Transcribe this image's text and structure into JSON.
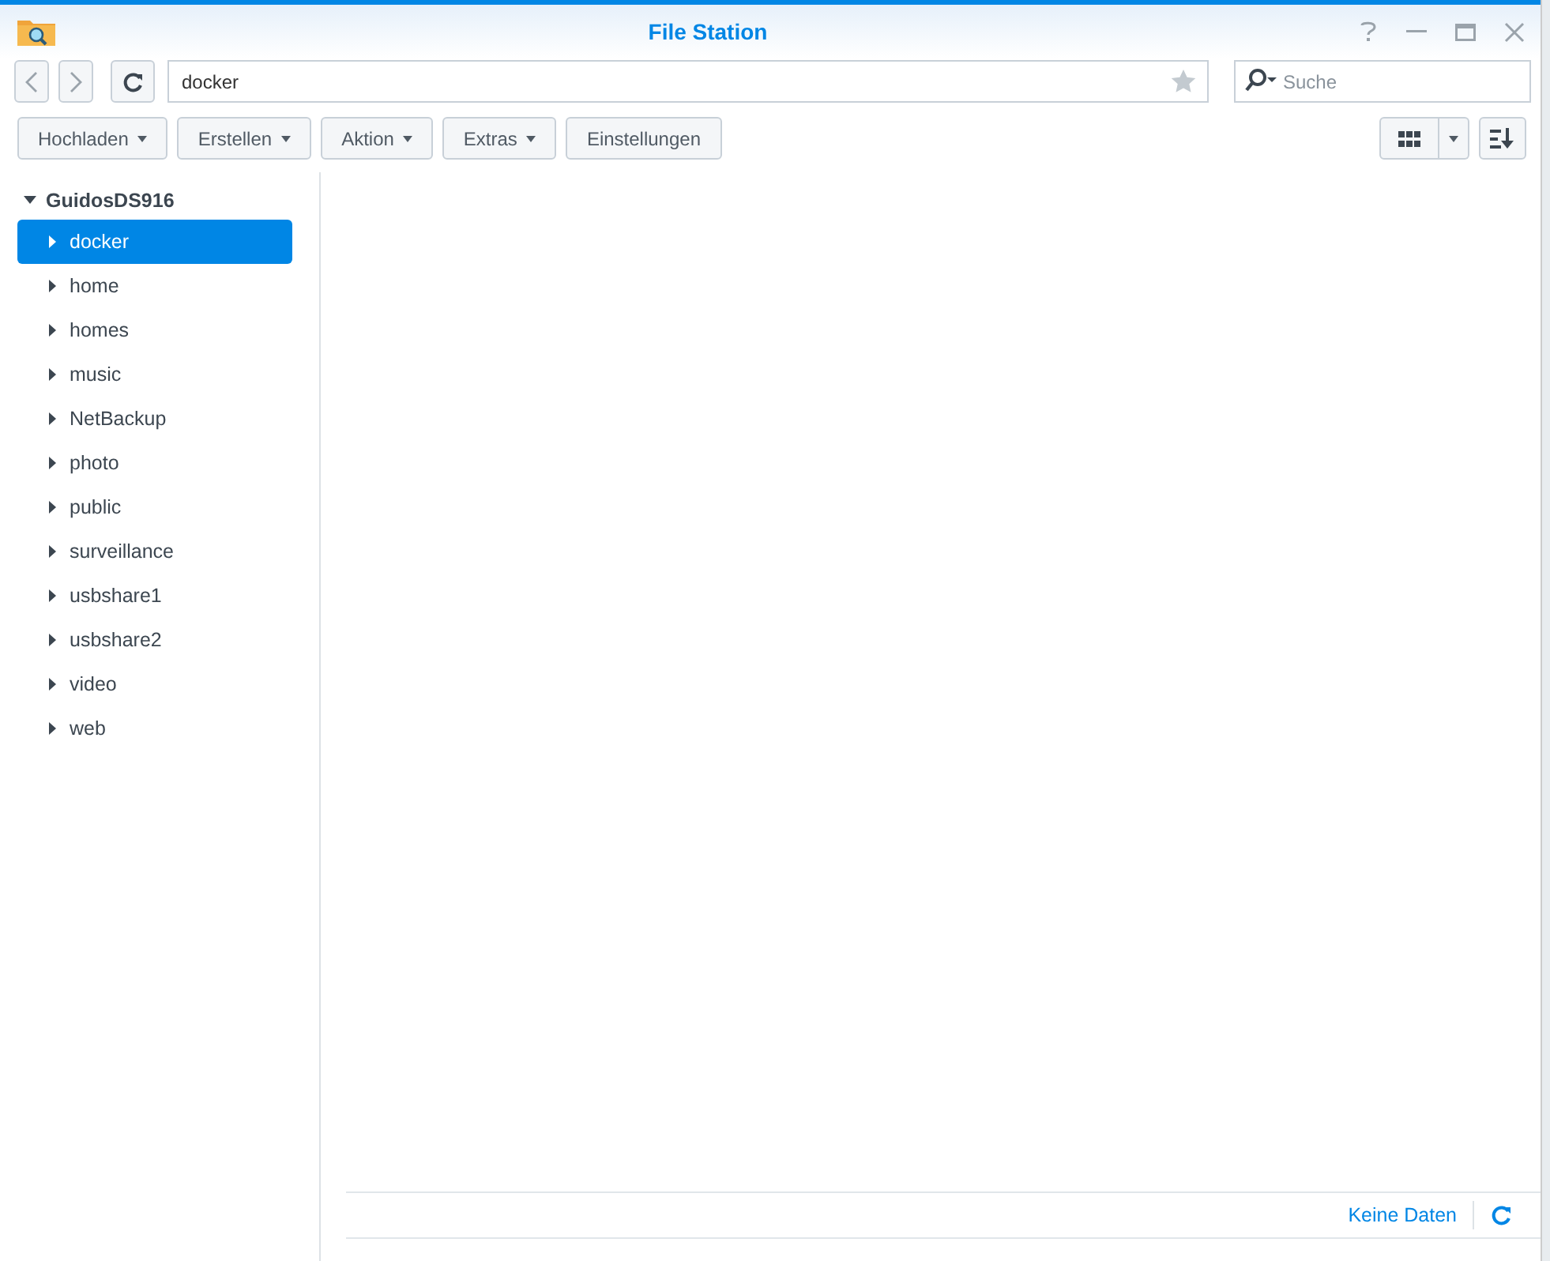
{
  "window": {
    "title": "File Station"
  },
  "path_field": {
    "value": "docker"
  },
  "search": {
    "placeholder": "Suche"
  },
  "toolbar": [
    {
      "label": "Hochladen",
      "dropdown": true
    },
    {
      "label": "Erstellen",
      "dropdown": true
    },
    {
      "label": "Aktion",
      "dropdown": true
    },
    {
      "label": "Extras",
      "dropdown": true
    },
    {
      "label": "Einstellungen",
      "dropdown": false
    }
  ],
  "tree": {
    "label": "GuidosDS916",
    "expanded": true,
    "children": [
      {
        "label": "docker",
        "selected": true
      },
      {
        "label": "home",
        "selected": false
      },
      {
        "label": "homes",
        "selected": false
      },
      {
        "label": "music",
        "selected": false
      },
      {
        "label": "NetBackup",
        "selected": false
      },
      {
        "label": "photo",
        "selected": false
      },
      {
        "label": "public",
        "selected": false
      },
      {
        "label": "surveillance",
        "selected": false
      },
      {
        "label": "usbshare1",
        "selected": false
      },
      {
        "label": "usbshare2",
        "selected": false
      },
      {
        "label": "video",
        "selected": false
      },
      {
        "label": "web",
        "selected": false
      }
    ]
  },
  "status_bar": {
    "text": "Keine Daten"
  }
}
